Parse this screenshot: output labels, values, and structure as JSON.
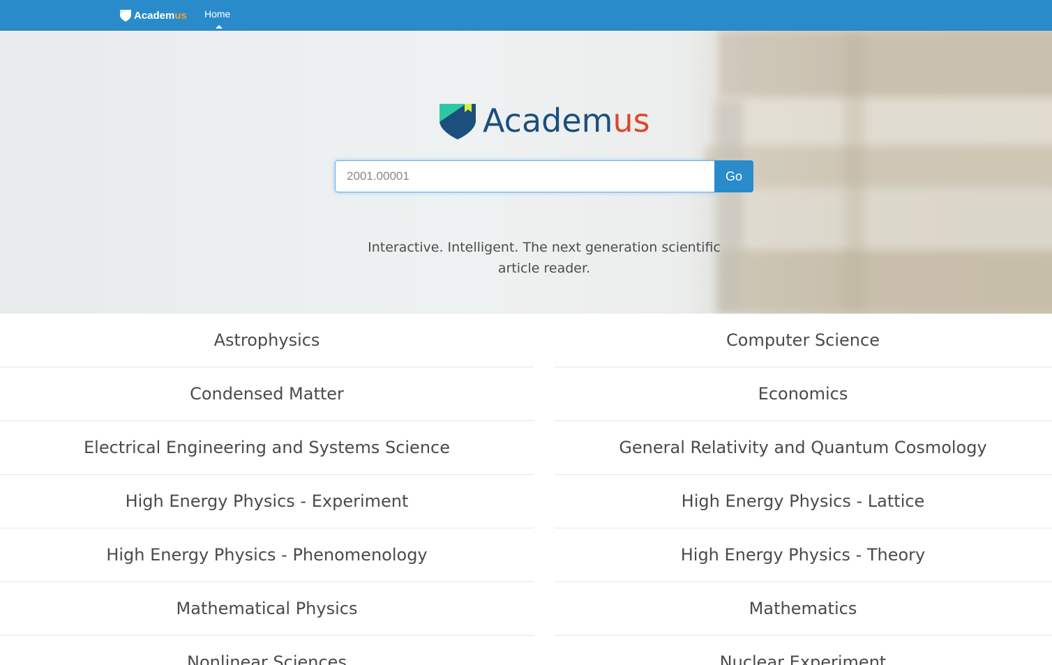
{
  "navbar": {
    "brand_main": "Academ",
    "brand_accent": "us",
    "home_label": "Home"
  },
  "hero": {
    "logo_main": "Academ",
    "logo_accent": "us",
    "search": {
      "placeholder": "2001.00001",
      "value": ""
    },
    "go_label": "Go",
    "tagline_line1": "Interactive. Intelligent. The next generation scientific",
    "tagline_line2": "article reader."
  },
  "categories": {
    "left": [
      "Astrophysics",
      "Condensed Matter",
      "Electrical Engineering and Systems Science",
      "High Energy Physics - Experiment",
      "High Energy Physics - Phenomenology",
      "Mathematical Physics",
      "Nonlinear Sciences"
    ],
    "right": [
      "Computer Science",
      "Economics",
      "General Relativity and Quantum Cosmology",
      "High Energy Physics - Lattice",
      "High Energy Physics - Theory",
      "Mathematics",
      "Nuclear Experiment"
    ]
  },
  "colors": {
    "navbar": "#2a8bca",
    "brand_accent": "#f0a030",
    "logo_main": "#1c4f7d",
    "logo_accent": "#e0452a"
  }
}
